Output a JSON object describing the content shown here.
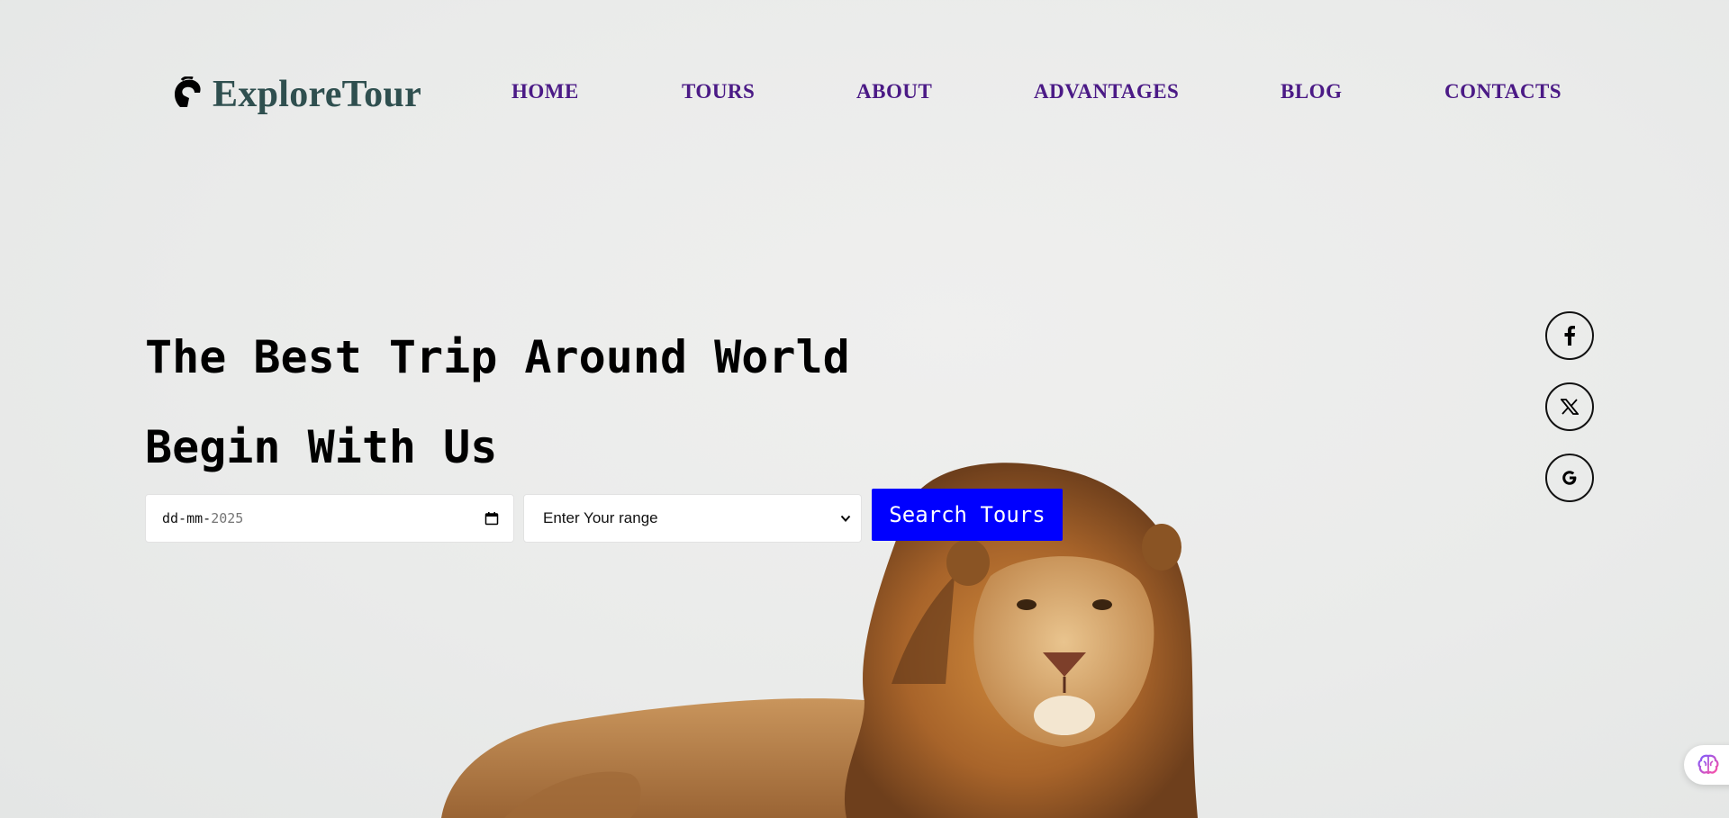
{
  "header": {
    "brand": "ExploreTour",
    "nav": [
      {
        "label": "HOME"
      },
      {
        "label": "TOURS"
      },
      {
        "label": "ABOUT"
      },
      {
        "label": "ADVANTAGES"
      },
      {
        "label": "BLOG"
      },
      {
        "label": "CONTACTS"
      }
    ]
  },
  "hero": {
    "title_line1": "The Best Trip Around World",
    "title_line2": "Begin With Us"
  },
  "search": {
    "date_placeholder": "dd-mm-",
    "date_year": "2025",
    "range_selected": "Enter Your range",
    "button_label": "Search Tours"
  },
  "social": [
    {
      "icon": "facebook-icon"
    },
    {
      "icon": "x-icon"
    },
    {
      "icon": "google-icon"
    }
  ],
  "colors": {
    "nav": "#4b1a86",
    "brand": "#2f4f4f",
    "button": "#0000ff",
    "background": "#ebebea"
  }
}
